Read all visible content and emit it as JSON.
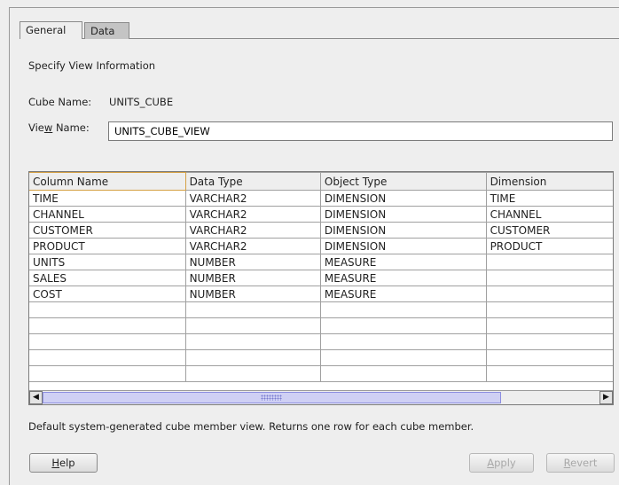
{
  "tabs": [
    {
      "label": "General",
      "active": true
    },
    {
      "label": "Data",
      "active": false
    }
  ],
  "section_title": "Specify View Information",
  "cube": {
    "label": "Cube Name:",
    "value": "UNITS_CUBE"
  },
  "view": {
    "label_pre": "Vie",
    "label_mn": "w",
    "label_post": " Name:",
    "value": "UNITS_CUBE_VIEW"
  },
  "table": {
    "headers": [
      "Column Name",
      "Data Type",
      "Object Type",
      "Dimension"
    ],
    "rows": [
      [
        "TIME",
        "VARCHAR2",
        "DIMENSION",
        "TIME"
      ],
      [
        "CHANNEL",
        "VARCHAR2",
        "DIMENSION",
        "CHANNEL"
      ],
      [
        "CUSTOMER",
        "VARCHAR2",
        "DIMENSION",
        "CUSTOMER"
      ],
      [
        "PRODUCT",
        "VARCHAR2",
        "DIMENSION",
        "PRODUCT"
      ],
      [
        "UNITS",
        "NUMBER",
        "MEASURE",
        ""
      ],
      [
        "SALES",
        "NUMBER",
        "MEASURE",
        ""
      ],
      [
        "COST",
        "NUMBER",
        "MEASURE",
        ""
      ]
    ]
  },
  "scrollbar": {
    "left_icon": "left-arrow-icon",
    "right_icon": "right-arrow-icon"
  },
  "footnote": "Default system-generated cube member view. Returns one row for each cube member.",
  "buttons": {
    "help": {
      "mn": "H",
      "rest": "elp"
    },
    "apply": {
      "mn": "A",
      "rest": "pply",
      "enabled": false
    },
    "revert": {
      "mn": "R",
      "rest": "evert",
      "enabled": false
    }
  },
  "colors": {
    "header_focus": "#d4a044",
    "scroll_thumb": "#cfd0f4"
  }
}
